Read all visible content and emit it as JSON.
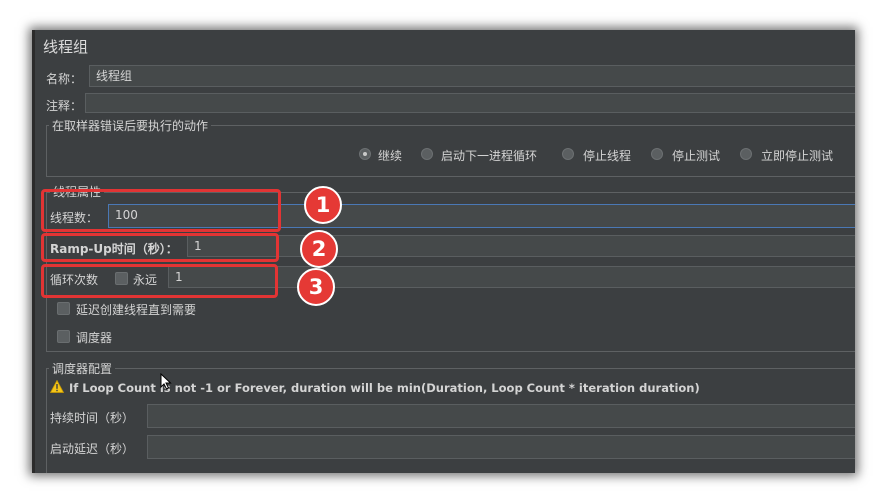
{
  "panel": {
    "title": "线程组",
    "name_label": "名称：",
    "name_value": "线程组",
    "comment_label": "注释：",
    "comment_value": ""
  },
  "error_action": {
    "group_title": "在取样器错误后要执行的动作",
    "options": [
      {
        "label": "继续",
        "selected": true
      },
      {
        "label": "启动下一进程循环",
        "selected": false
      },
      {
        "label": "停止线程",
        "selected": false
      },
      {
        "label": "停止测试",
        "selected": false
      },
      {
        "label": "立即停止测试",
        "selected": false
      }
    ]
  },
  "thread_props": {
    "group_title": "线程属性",
    "threads_label": "线程数：",
    "threads_value": "100",
    "rampup_label": "Ramp-Up时间（秒）：",
    "rampup_value": "1",
    "loop_label": "循环次数",
    "forever_label": "永远",
    "loop_value": "1",
    "delay_label": "延迟创建线程直到需要",
    "scheduler_label": "调度器"
  },
  "scheduler": {
    "group_title": "调度器配置",
    "warning": "If Loop Count is not -1 or Forever, duration will be min(Duration, Loop Count * iteration duration)",
    "duration_label": "持续时间（秒）",
    "duration_value": "",
    "delay_label": "启动延迟（秒）",
    "delay_value": ""
  },
  "annotations": {
    "badge1": "1",
    "badge2": "2",
    "badge3": "3",
    "highlight_color": "#e23434"
  },
  "colors": {
    "background": "#3c3f41",
    "input": "#45494a",
    "focus": "#4a78b5",
    "warning": "#f5c518"
  }
}
